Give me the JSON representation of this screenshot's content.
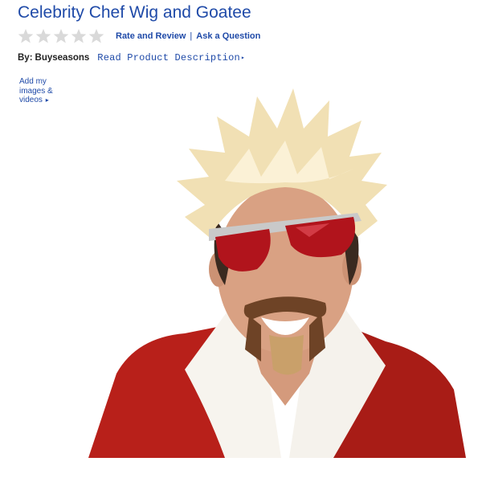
{
  "product": {
    "title": "Celebrity Chef Wig and Goatee",
    "rating": {
      "stars_filled": 0,
      "stars_total": 5
    },
    "rate_review_label": "Rate and Review",
    "separator": "|",
    "ask_question_label": "Ask a Question",
    "by_label": "By:",
    "brand": "Buyseasons",
    "read_description_label": "Read Product Description",
    "add_media_label": "Add my images & videos"
  },
  "icons": {
    "star": "star-icon",
    "arrow": "triangle-right-icon"
  },
  "colors": {
    "link": "#1f4aa8",
    "star_empty": "#d9d9d9",
    "text": "#222222"
  }
}
